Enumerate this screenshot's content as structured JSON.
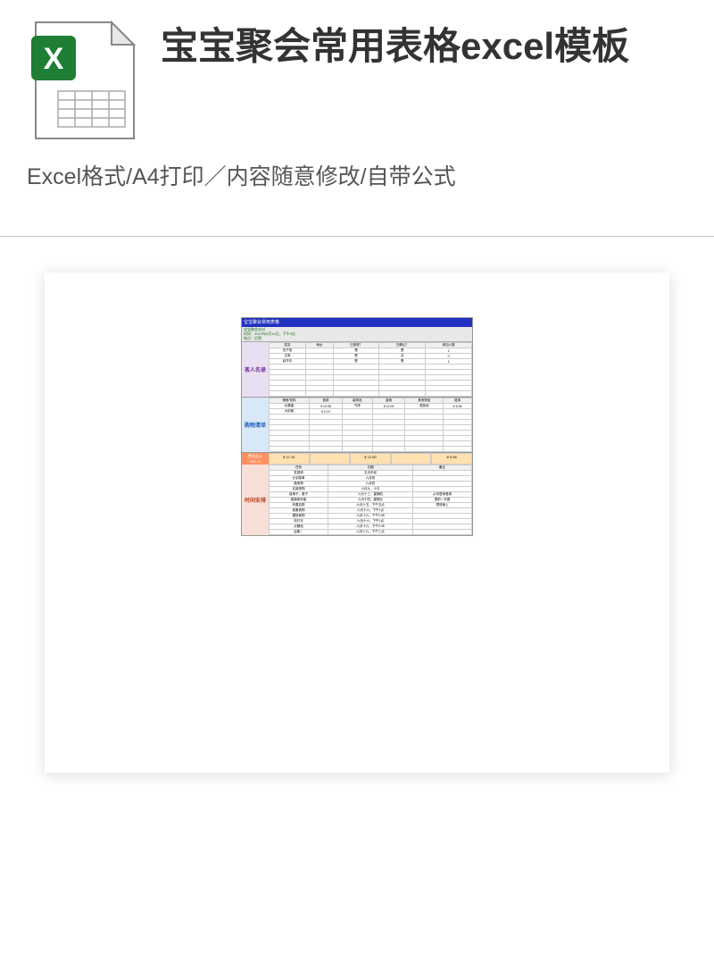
{
  "title": "宝宝聚会常用表格excel模板",
  "subtitle": "Excel格式/A4打印／内容随意修改/自带公式",
  "sheet": {
    "banner": "宝宝聚会常用表格",
    "meta_line1": "宝宝聚会派对",
    "meta_line2": "时间：2012年6月14日，下午3点",
    "meta_line3": "地点：后院",
    "guests": {
      "label": "客人名录",
      "headers": [
        "姓名",
        "地址",
        "已邀请？",
        "已确认？",
        "参加人数"
      ],
      "rows": [
        [
          "张子成",
          "",
          "是",
          "是",
          "2"
        ],
        [
          "文英",
          "",
          "是",
          "否",
          "0"
        ],
        [
          "赵华中",
          "",
          "是",
          "是",
          "1"
        ]
      ],
      "empty_rows": 6
    },
    "shopping": {
      "label": "购物清单",
      "headers": [
        "储食/饮料",
        "费用",
        "装饰品",
        "费用",
        "其他物品",
        "费用"
      ],
      "rows": [
        [
          "水果盘",
          "¥  14.95",
          "气球",
          "¥  12.00",
          "奖励品",
          "¥  5.96"
        ],
        [
          "大奶瓶",
          "¥   2.19",
          "",
          "",
          "",
          ""
        ]
      ],
      "empty_rows": 7,
      "total_label": "费用总计",
      "total_value": "¥35.10",
      "totals": [
        "¥  17.14",
        "",
        "¥  12.00",
        "",
        "¥  5.96"
      ]
    },
    "schedule": {
      "label": "时间安排",
      "headers": [
        "任务",
        "日期",
        "备注"
      ],
      "rows": [
        [
          "发邀请",
          "五月中旬",
          ""
        ],
        [
          "计划菜单",
          "六月初",
          ""
        ],
        [
          "做食物",
          "六月初",
          ""
        ],
        [
          "买装饰物",
          "六月九、十日",
          ""
        ],
        [
          "接椅子，桌子",
          "六月十三，星期四",
          "从邻居家借用"
        ],
        [
          "做蔬菜凉盘",
          "六月十四，星期五",
          "提前一天做"
        ],
        [
          "布置后院",
          "六月十五，下午五点",
          "提前晚上"
        ],
        [
          "准备食物",
          "六月十六，下午1点",
          ""
        ],
        [
          "摆放食物",
          "六月十六，下午2:45",
          ""
        ],
        [
          "改灯光",
          "六月十六，下午1点",
          ""
        ],
        [
          "点蜡烛",
          "六月十六，下午2:45",
          ""
        ],
        [
          "迎客！",
          "六月十六，下午三点",
          ""
        ]
      ]
    }
  }
}
